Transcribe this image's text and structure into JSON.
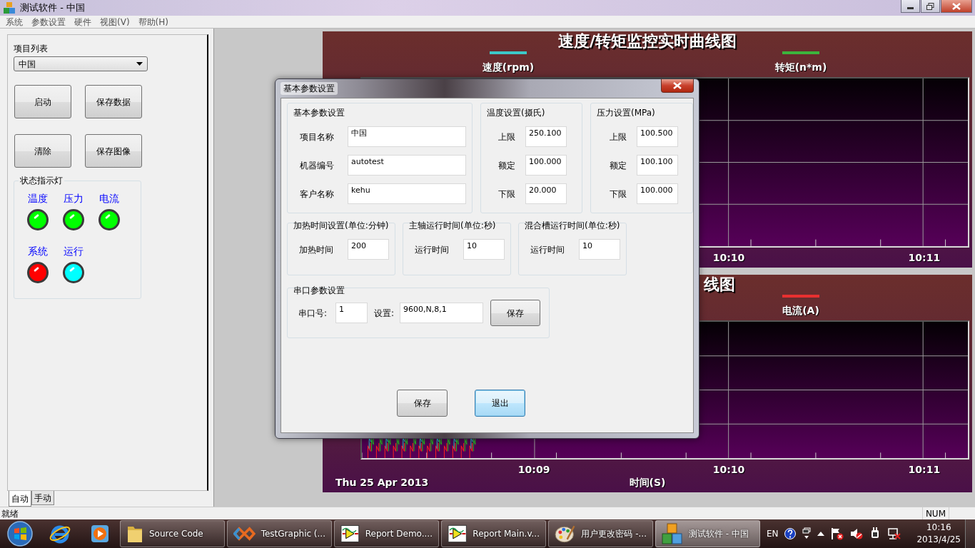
{
  "window": {
    "title": "测试软件 - 中国"
  },
  "menu": [
    "系统",
    "参数设置",
    "硬件",
    "视图(V)",
    "帮助(H)"
  ],
  "sidebar": {
    "project_label": "项目列表",
    "project": "中国",
    "buttons": [
      "启动",
      "保存数据",
      "清除",
      "保存图像"
    ],
    "indicators": {
      "title": "状态指示灯",
      "lights": [
        {
          "label": "温度",
          "color": "#00ff00"
        },
        {
          "label": "压力",
          "color": "#00ff00"
        },
        {
          "label": "电流",
          "color": "#00ff00"
        },
        {
          "label": "系统",
          "color": "#ff0000"
        },
        {
          "label": "运行",
          "color": "#00ffff"
        }
      ]
    },
    "tabs": [
      {
        "label": "自动",
        "selected": true
      },
      {
        "label": "手动",
        "selected": false
      }
    ]
  },
  "charts": [
    {
      "title": "速度/转矩监控实时曲线图",
      "legend": [
        {
          "label": "速度(rpm)",
          "color": "#3cc8c8"
        },
        {
          "label": "转矩(n*m)",
          "color": "#3cb43c"
        }
      ],
      "x_ticks": [
        "10:10",
        "10:11"
      ]
    },
    {
      "title": "线图",
      "legend": [
        {
          "label": "电流(A)",
          "color": "#e83030"
        }
      ],
      "x_ticks": [
        "10:09",
        "10:10",
        "10:11"
      ],
      "traces": true,
      "date": "Thu 25 Apr 2013",
      "xlabel": "时间(S)"
    }
  ],
  "dialog": {
    "title": "基本参数设置",
    "groups": [
      {
        "title": "基本参数设置",
        "fields": [
          {
            "label": "项目名称",
            "value": "中国"
          },
          {
            "label": "机器编号",
            "value": "autotest"
          },
          {
            "label": "客户名称",
            "value": "kehu"
          }
        ]
      },
      {
        "title": "温度设置(摄氏)",
        "fields": [
          {
            "label": "上限",
            "value": "250.100"
          },
          {
            "label": "额定",
            "value": "100.000"
          },
          {
            "label": "下限",
            "value": "20.000"
          }
        ]
      },
      {
        "title": "压力设置(MPa)",
        "fields": [
          {
            "label": "上限",
            "value": "100.500"
          },
          {
            "label": "额定",
            "value": "100.100"
          },
          {
            "label": "下限",
            "value": "100.000"
          }
        ]
      },
      {
        "title": "加热时间设置(单位:分钟)",
        "fields": [
          {
            "label": "加热时间",
            "value": "200"
          }
        ]
      },
      {
        "title": "主轴运行时间(单位:秒)",
        "fields": [
          {
            "label": "运行时间",
            "value": "10"
          }
        ]
      },
      {
        "title": "混合槽运行时间(单位:秒)",
        "fields": [
          {
            "label": "运行时间",
            "value": "10"
          }
        ]
      }
    ],
    "serial": {
      "title": "串口参数设置",
      "port_label": "串口号:",
      "port": "1",
      "settings_label": "设置:",
      "settings": "9600,N,8,1",
      "button": "保存"
    },
    "buttons": [
      {
        "label": "保存",
        "default": false
      },
      {
        "label": "退出",
        "default": true
      }
    ]
  },
  "status_bar": {
    "message": "就绪",
    "indicator": "NUM"
  },
  "taskbar": {
    "items": [
      {
        "label": "Source Code",
        "kind": "folder",
        "selected": false
      },
      {
        "label": "TestGraphic (...",
        "kind": "studio",
        "selected": false
      },
      {
        "label": "Report Demo....",
        "kind": "labview",
        "selected": false
      },
      {
        "label": "Report Main.v...",
        "kind": "labview",
        "selected": false
      },
      {
        "label": "用户更改密码 -...",
        "kind": "palette",
        "selected": false
      },
      {
        "label": "测试软件 - 中国",
        "kind": "blocks",
        "selected": true
      }
    ],
    "language": "EN",
    "time": "10:16",
    "date": "2013/4/25"
  }
}
